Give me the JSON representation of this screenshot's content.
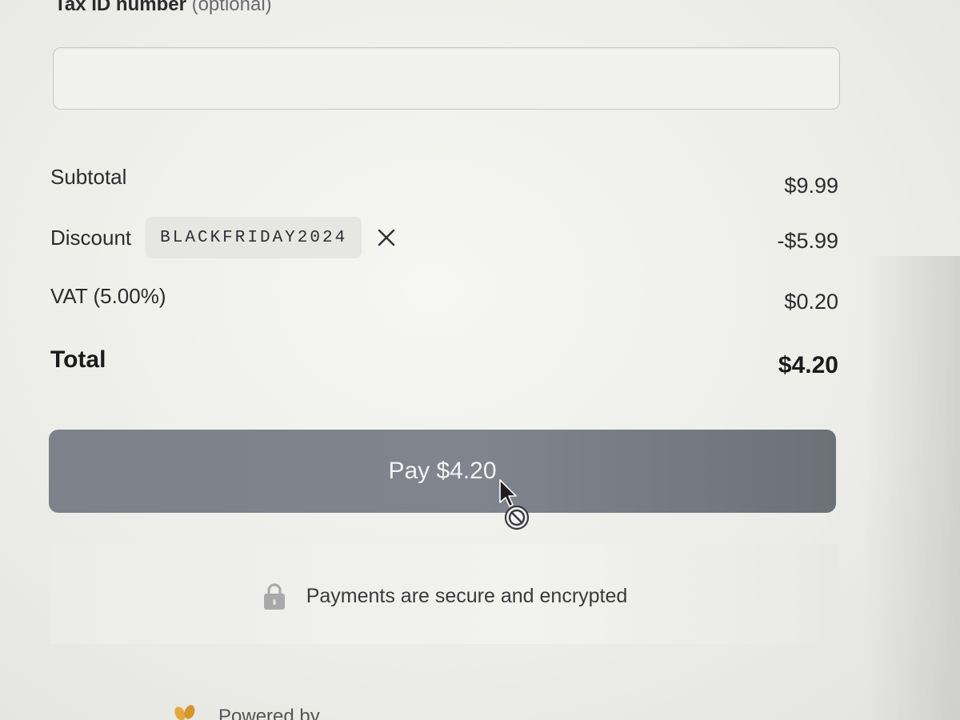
{
  "tax_id": {
    "label": "Tax ID number",
    "optional": "(optional)",
    "value": ""
  },
  "summary": {
    "subtotal": {
      "label": "Subtotal",
      "value": "$9.99"
    },
    "discount": {
      "label": "Discount",
      "code": "BLACKFRIDAY2024",
      "value": "-$5.99"
    },
    "vat": {
      "label": "VAT (5.00%)",
      "value": "$0.20"
    },
    "total": {
      "label": "Total",
      "value": "$4.20"
    }
  },
  "pay_button": {
    "label": "Pay $4.20",
    "state": "disabled"
  },
  "security": {
    "text": "Payments are secure and encrypted"
  },
  "footer": {
    "text": "Powered by"
  },
  "icons": {
    "remove_discount": "close-icon",
    "security": "lock-icon",
    "cursor": "not-allowed-cursor-icon",
    "brand": "brand-logo-icon"
  },
  "colors": {
    "pay_button": "#7d828a",
    "background": "#eeeeea",
    "text": "#2c2c30"
  }
}
